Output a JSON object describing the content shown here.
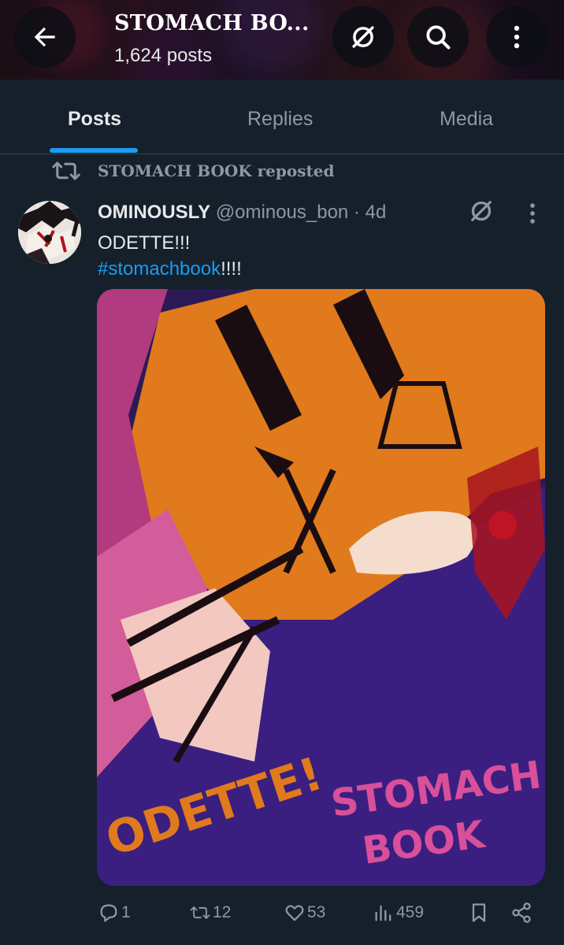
{
  "header": {
    "title": "STOMACH BO...",
    "post_count": "1,624 posts"
  },
  "tabs": [
    {
      "label": "Posts",
      "active": true
    },
    {
      "label": "Replies",
      "active": false
    },
    {
      "label": "Media",
      "active": false
    }
  ],
  "repost": {
    "text": "STOMACH BOOK reposted",
    "icon": "repost-icon"
  },
  "post": {
    "author": "OMINOUSLY",
    "handle": "@ominous_bon",
    "separator": "·",
    "time_ago": "4d",
    "text_line1": "ODETTE!!!",
    "hashtag": "#stomachbook",
    "hashtag_suffix": "!!!!",
    "media_alt": "Illustrated artwork of a character with the words ODETTE! and STOMACH BOOK",
    "media_text_1": "ODETTE!",
    "media_text_2": "STOMACH",
    "media_text_3": "BOOK"
  },
  "actions": {
    "replies": "1",
    "reposts": "12",
    "likes": "53",
    "views": "459"
  },
  "colors": {
    "background": "#15202b",
    "accent": "#1d9bf0",
    "muted": "#8b98a5",
    "text": "#e7e9ea"
  }
}
